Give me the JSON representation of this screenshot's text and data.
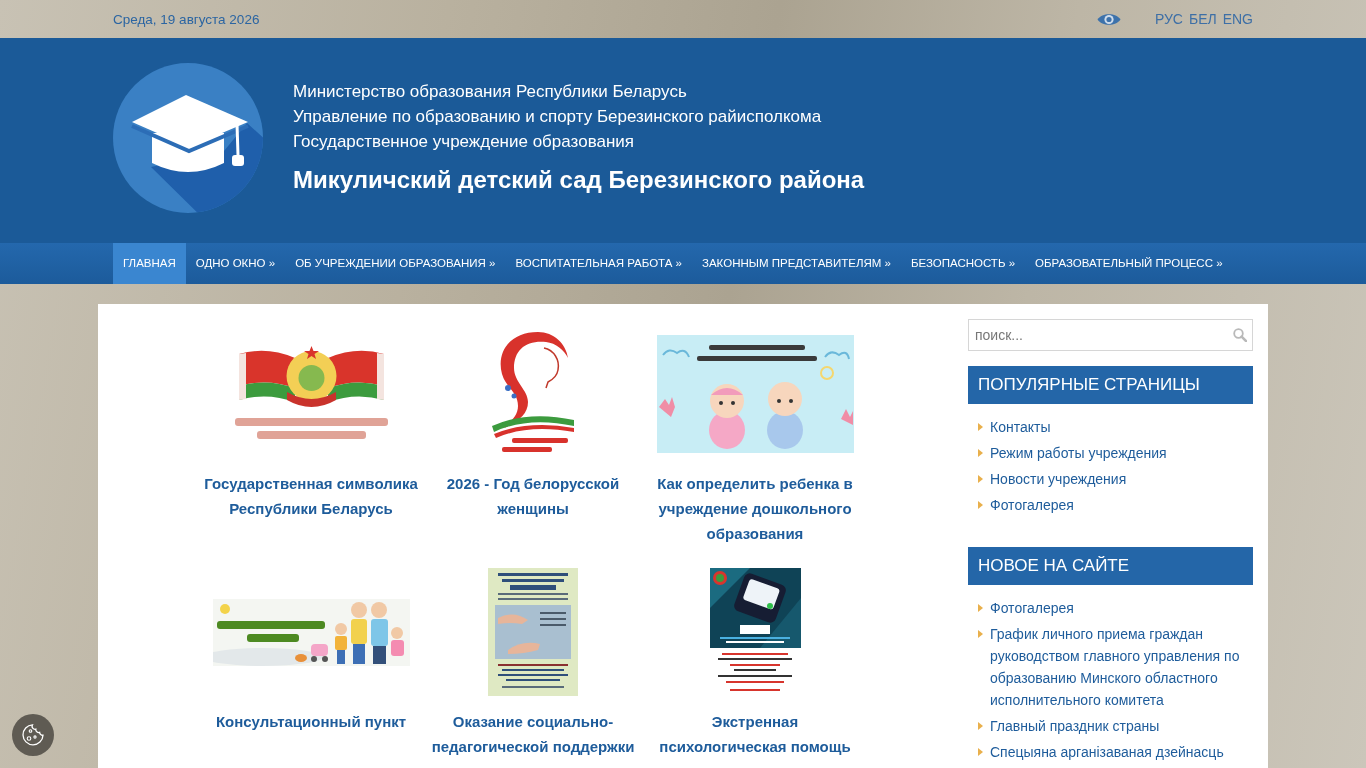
{
  "top_bar": {
    "date": "Среда, 19 августа 2026",
    "languages": [
      "РУС",
      "БЕЛ",
      "ENG"
    ]
  },
  "header": {
    "lines": [
      "Министерство образования Республики Беларусь",
      "Управление по образованию и спорту Березинского райисполкома",
      "Государственное учреждение образования"
    ],
    "title": "Микуличский детский сад Березинского района"
  },
  "nav": [
    {
      "label": "ГЛАВНАЯ",
      "selected": true
    },
    {
      "label": "ОДНО ОКНО »",
      "selected": false
    },
    {
      "label": "ОБ УЧРЕЖДЕНИИ ОБРАЗОВАНИЯ »",
      "selected": false
    },
    {
      "label": "ВОСПИТАТЕЛЬНАЯ РАБОТА »",
      "selected": false
    },
    {
      "label": "ЗАКОННЫМ ПРЕДСТАВИТЕЛЯМ »",
      "selected": false
    },
    {
      "label": "БЕЗОПАСНОСТЬ »",
      "selected": false
    },
    {
      "label": "ОБРАЗОВАТЕЛЬНЫЙ ПРОЦЕСС »",
      "selected": false
    }
  ],
  "cards": [
    {
      "kind": "flags",
      "title": "Государственная символика Республики Беларусь"
    },
    {
      "kind": "ribbon",
      "title": "2026 - Год белорусской женщины"
    },
    {
      "kind": "babies",
      "title": "Как определить ребенка в учреждение дошкольного образования"
    },
    {
      "kind": "family",
      "title": "Консультационный пункт"
    },
    {
      "kind": "leaflet",
      "title": "Оказание социально-педагогической поддержки"
    },
    {
      "kind": "phone",
      "title": "Экстренная психологическая помощь"
    }
  ],
  "sidebar": {
    "search": {
      "placeholder": "поиск..."
    },
    "widgets": [
      {
        "title": "ПОПУЛЯРНЫЕ СТРАНИЦЫ",
        "items": [
          "Контакты",
          "Режим работы учреждения",
          "Новости учреждения",
          "Фотогалерея"
        ]
      },
      {
        "title": "НОВОЕ НА САЙТЕ",
        "items": [
          "Фотогалерея",
          "График личного приема граждан руководством главного управления по образованию Минского областного исполнительного комитета",
          "Главный праздник страны",
          "Спецыяна арганізаваная дзейнасць"
        ]
      }
    ]
  }
}
